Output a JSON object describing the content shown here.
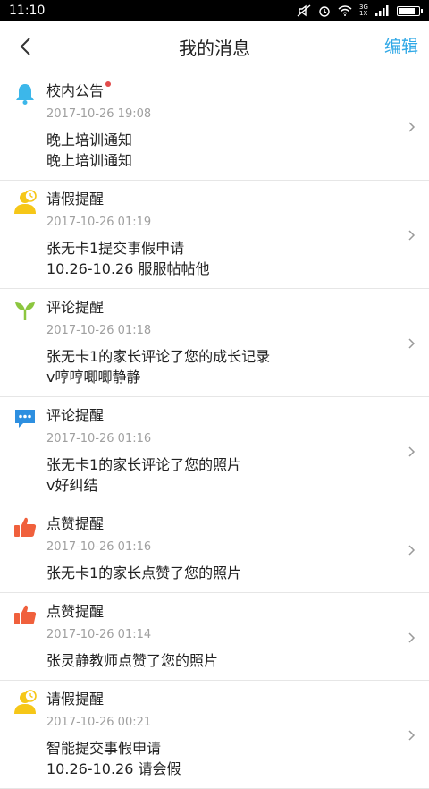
{
  "status": {
    "time": "11:10",
    "network": "3G 1X"
  },
  "header": {
    "title": "我的消息",
    "edit": "编辑"
  },
  "messages": [
    {
      "icon": "bell-icon",
      "title": "校内公告",
      "unread": true,
      "time": "2017-10-26 19:08",
      "lines": [
        "晚上培训通知",
        "晚上培训通知"
      ]
    },
    {
      "icon": "leave-request-icon",
      "title": "请假提醒",
      "unread": false,
      "time": "2017-10-26 01:19",
      "lines": [
        "张无卡1提交事假申请",
        "10.26-10.26 服服帖帖他"
      ]
    },
    {
      "icon": "sprout-icon",
      "title": "评论提醒",
      "unread": false,
      "time": "2017-10-26 01:18",
      "lines": [
        "张无卡1的家长评论了您的成长记录",
        "v哼哼唧唧静静"
      ]
    },
    {
      "icon": "chat-bubble-icon",
      "title": "评论提醒",
      "unread": false,
      "time": "2017-10-26 01:16",
      "lines": [
        "张无卡1的家长评论了您的照片",
        "v好纠结"
      ]
    },
    {
      "icon": "thumbs-up-icon",
      "title": "点赞提醒",
      "unread": false,
      "time": "2017-10-26 01:16",
      "lines": [
        "张无卡1的家长点赞了您的照片"
      ]
    },
    {
      "icon": "thumbs-up-icon",
      "title": "点赞提醒",
      "unread": false,
      "time": "2017-10-26 01:14",
      "lines": [
        "张灵静教师点赞了您的照片"
      ]
    },
    {
      "icon": "leave-request-icon",
      "title": "请假提醒",
      "unread": false,
      "time": "2017-10-26 00:21",
      "lines": [
        "智能提交事假申请",
        "10.26-10.26 请会假"
      ]
    }
  ]
}
